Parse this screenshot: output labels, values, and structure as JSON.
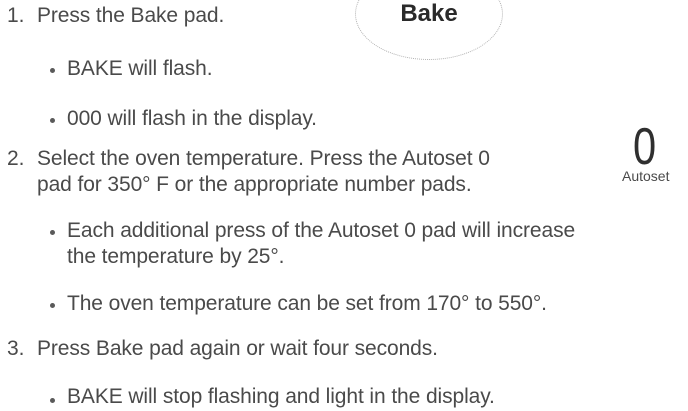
{
  "bake_button": {
    "label": "Bake"
  },
  "autoset_button": {
    "digit": "0",
    "label": "Autoset"
  },
  "steps": [
    {
      "number": "1.",
      "lines": [
        "Press the Bake pad."
      ],
      "bullets": [
        [
          "BAKE will flash."
        ],
        [
          "000 will flash in the display."
        ]
      ]
    },
    {
      "number": "2.",
      "lines": [
        "Select the oven temperature.  Press the Autoset 0",
        "pad for 350° F or the appropriate number pads."
      ],
      "bullets": [
        [
          "Each additional press of the Autoset 0 pad will increase",
          "the temperature by 25°."
        ],
        [
          "The oven temperature can be set from 170° to 550°."
        ]
      ]
    },
    {
      "number": "3.",
      "lines": [
        "Press Bake pad again or wait four seconds."
      ],
      "bullets": [
        [
          "BAKE will stop flashing and light in the display."
        ]
      ]
    }
  ]
}
